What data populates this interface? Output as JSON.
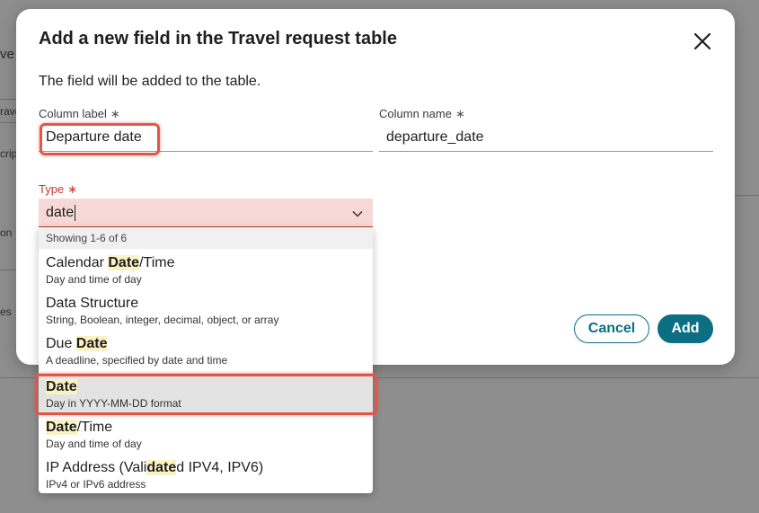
{
  "background": {
    "fragments": [
      "ve",
      "rave",
      "cript",
      "on",
      "es"
    ]
  },
  "dialog": {
    "title": "Add a new field in the Travel request table",
    "subtitle": "The field will be added to the table.",
    "column_label": {
      "label": "Column label",
      "required_mark": "∗",
      "value": "Departure date"
    },
    "column_name": {
      "label": "Column name",
      "required_mark": "∗",
      "value": "departure_date"
    },
    "type": {
      "label": "Type",
      "required_mark": "∗",
      "value": "date"
    },
    "buttons": {
      "cancel": "Cancel",
      "add": "Add"
    }
  },
  "dropdown": {
    "header": "Showing 1-6 of 6",
    "options": [
      {
        "pre": "Calendar ",
        "hl": "Date",
        "post": "/Time",
        "desc": "Day and time of day"
      },
      {
        "pre": "Data Structure",
        "hl": "",
        "post": "",
        "desc": "String, Boolean, integer, decimal, object, or array"
      },
      {
        "pre": "Due ",
        "hl": "Date",
        "post": "",
        "desc": "A deadline, specified by date and time"
      },
      {
        "pre": "",
        "hl": "Date",
        "post": "",
        "desc": "Day in YYYY-MM-DD format",
        "selected": true
      },
      {
        "pre": "",
        "hl": "Date",
        "post": "/Time",
        "desc": "Day and time of day"
      },
      {
        "pre": "IP Address (Vali",
        "hl": "date",
        "post": "d IPV4, IPV6)",
        "desc": "IPv4 or IPv6 address"
      }
    ]
  },
  "colors": {
    "accent": "#0b6e82",
    "error": "#c0392b",
    "highlight_border": "#e0574a",
    "match_highlight": "#fbf2c4"
  }
}
